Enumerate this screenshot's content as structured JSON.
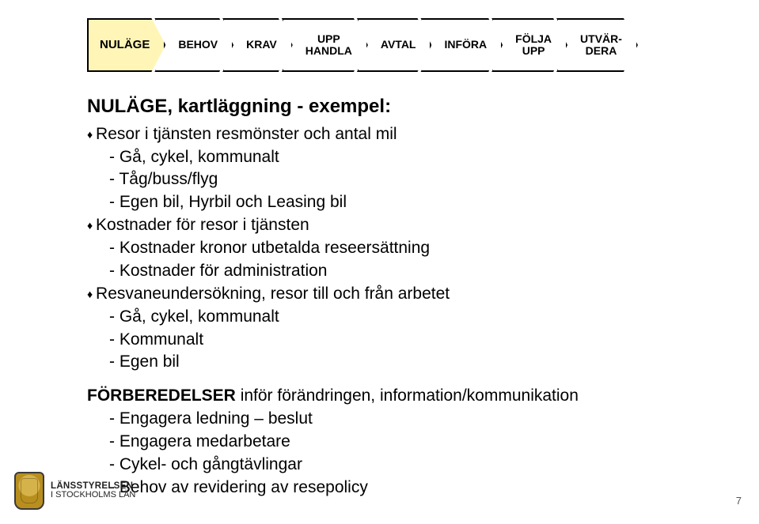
{
  "steps": [
    {
      "label": "NULÄGE",
      "active": true
    },
    {
      "label": "BEHOV",
      "active": false
    },
    {
      "label": "KRAV",
      "active": false
    },
    {
      "label": "UPP\nHANDLA",
      "active": false
    },
    {
      "label": "AVTAL",
      "active": false
    },
    {
      "label": "INFÖRA",
      "active": false
    },
    {
      "label": "FÖLJA\nUPP",
      "active": false
    },
    {
      "label": "UTVÄR-\nDERA",
      "active": false
    }
  ],
  "title": "NULÄGE, kartläggning - exempel:",
  "lines": [
    {
      "t": "dia",
      "text": "Resor i tjänsten resmönster och antal mil"
    },
    {
      "t": "dash",
      "text": "Gå, cykel, kommunalt"
    },
    {
      "t": "dash",
      "text": "Tåg/buss/flyg"
    },
    {
      "t": "dash",
      "text": "Egen bil, Hyrbil och Leasing bil"
    },
    {
      "t": "dia",
      "text": "Kostnader för resor i tjänsten"
    },
    {
      "t": "dash",
      "text": "Kostnader kronor utbetalda reseersättning"
    },
    {
      "t": "dash",
      "text": "Kostnader för administration"
    },
    {
      "t": "dia",
      "text": "Resvaneundersökning, resor till och från arbetet"
    },
    {
      "t": "dash",
      "text": "Gå, cykel, kommunalt"
    },
    {
      "t": "dash",
      "text": "Kommunalt"
    },
    {
      "t": "dash",
      "text": "Egen bil"
    }
  ],
  "block2_lead": "FÖRBEREDELSER",
  "block2_rest": " inför förändringen, information/kommunikation",
  "lines2": [
    {
      "t": "dash",
      "text": "Engagera ledning – beslut"
    },
    {
      "t": "dash",
      "text": "Engagera medarbetare"
    },
    {
      "t": "dash",
      "text": "Cykel- och gångtävlingar"
    },
    {
      "t": "dash",
      "text": "Behov av revidering av resepolicy"
    }
  ],
  "logo": {
    "line1": "LÄNSSTYRELSEN",
    "line2": "I STOCKHOLMS LÄN"
  },
  "pagenum": "7"
}
